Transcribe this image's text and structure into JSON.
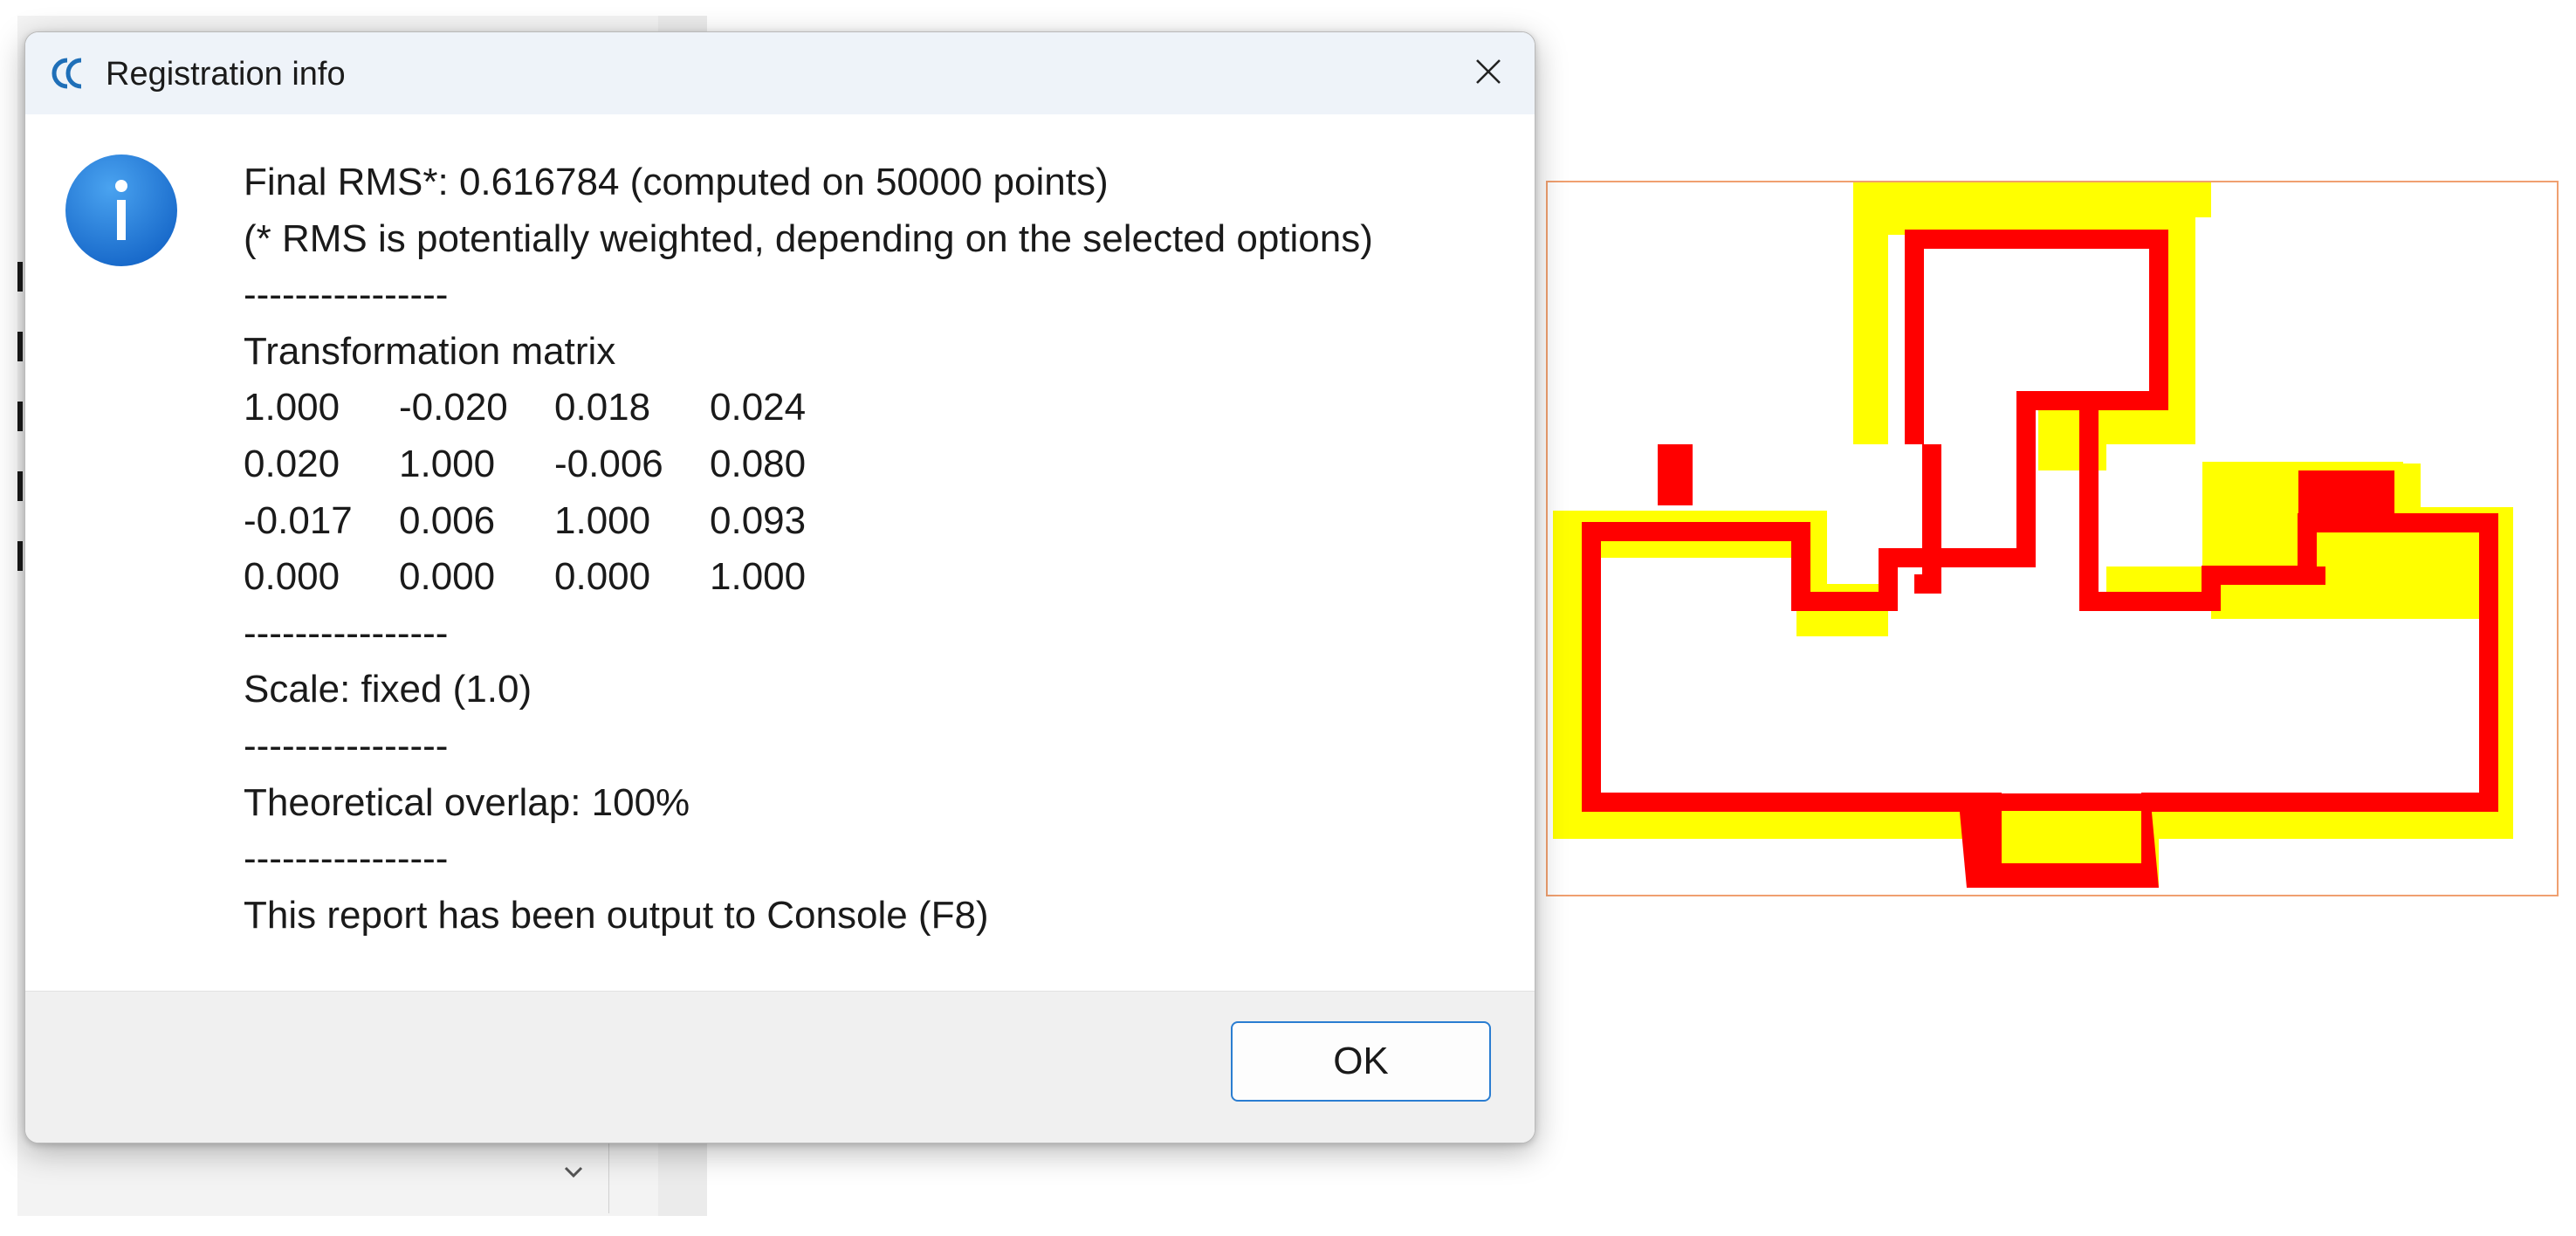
{
  "dialog": {
    "title": "Registration info",
    "close_icon": "close-icon",
    "app_icon": "cloudcompare-logo-icon",
    "info_icon": "info-icon",
    "lines": {
      "final_rms": "Final RMS*: 0.616784 (computed on 50000 points)",
      "rms_note": "(* RMS is potentially weighted, depending on the selected options)",
      "separator_1": "----------------",
      "matrix_title": "Transformation matrix",
      "separator_2": "----------------",
      "scale": "Scale: fixed (1.0)",
      "separator_3": "----------------",
      "overlap": "Theoretical overlap: 100%",
      "separator_4": "----------------",
      "console_note": "This report has been output to Console (F8)"
    },
    "matrix": [
      [
        "1.000",
        "-0.020",
        "0.018",
        "0.024"
      ],
      [
        "0.020",
        "1.000",
        "-0.006",
        "0.080"
      ],
      [
        "-0.017",
        "0.006",
        "1.000",
        "0.093"
      ],
      [
        "0.000",
        "0.000",
        "0.000",
        "1.000"
      ]
    ],
    "ok_label": "OK"
  },
  "background": {
    "chevron_icon": "chevron-down-icon"
  },
  "viewer": {
    "reference_cloud_color": "#ffff00",
    "aligned_cloud_color": "#ff0000",
    "bbox_color": "#f0a070"
  },
  "colors": {
    "accent": "#2a7dd1",
    "info_blue": "#1a73d6",
    "titlebar": "#eef3f9"
  }
}
